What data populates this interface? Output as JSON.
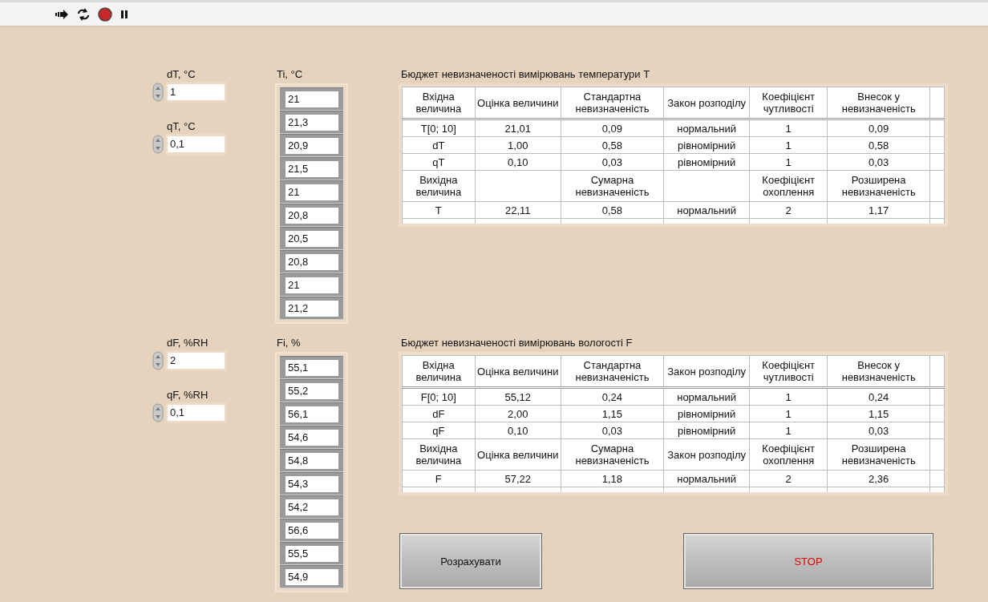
{
  "sections": [
    {
      "params": [
        {
          "label": "dT, °C",
          "value": "1"
        },
        {
          "label": "qT, °C",
          "value": "0,1"
        }
      ],
      "array": {
        "label": "Ti, °C",
        "items": [
          "21",
          "21,3",
          "20,9",
          "21,5",
          "21",
          "20,8",
          "20,5",
          "20,8",
          "21",
          "21,2"
        ]
      },
      "table": {
        "title": "Бюджет невизначеності вимірювань температури T",
        "header": [
          "Вхідна величина",
          "Оцінка величини",
          "Стандартна невизначеність",
          "Закон розподілу",
          "Коефіцієнт чутливості",
          "Внесок у невизначеність"
        ],
        "rows": [
          [
            "T[0; 10]",
            "21,01",
            "0,09",
            "нормальний",
            "1",
            "0,09"
          ],
          [
            "dT",
            "1,00",
            "0,58",
            "рівномірний",
            "1",
            "0,58"
          ],
          [
            "qT",
            "0,10",
            "0,03",
            "рівномірний",
            "1",
            "0,03"
          ]
        ],
        "output_header": {
          "quantity": "Вихідна величина",
          "uncertainty": "Сумарна невизначеність",
          "coefficient": "Коефіцієнт охоплення",
          "result": "Розширена невизначеність"
        },
        "output_rows": [
          [
            "T",
            "22,11",
            "0,58",
            "нормальний",
            "2",
            "1,17"
          ]
        ]
      }
    },
    {
      "params": [
        {
          "label": "dF, %RH",
          "value": "2"
        },
        {
          "label": "qF, %RH",
          "value": "0,1"
        }
      ],
      "array": {
        "label": "Fi,  %",
        "items": [
          "55,1",
          "55,2",
          "56,1",
          "54,6",
          "54,8",
          "54,3",
          "54,2",
          "56,6",
          "55,5",
          "54,9"
        ]
      },
      "table": {
        "title": "Бюджет невизначеності вимірювань вологості F",
        "header": [
          "Вхідна величина",
          "Оцінка величини",
          "Стандартна невизначеність",
          "Закон розподілу",
          "Коефіцієнт чутливості",
          "Внесок у невизначеність"
        ],
        "rows": [
          [
            "F[0; 10]",
            "55,12",
            "0,24",
            "нормальний",
            "1",
            "0,24"
          ],
          [
            "dF",
            "2,00",
            "1,15",
            "рівномірний",
            "1",
            "1,15"
          ],
          [
            "qF",
            "0,10",
            "0,03",
            "рівномірний",
            "1",
            "0,03"
          ]
        ],
        "output_header": {
          "quantity": "Вихідна величина",
          "estimate": "Оцінка величини",
          "uncertainty": "Сумарна невизначеність",
          "distribution": "Закон розподілу",
          "coefficient": "Коефіцієнт охоплення",
          "result": "Розширена невизначеність"
        },
        "output_rows": [
          [
            "F",
            "57,22",
            "1,18",
            "нормальний",
            "2",
            "2,36"
          ]
        ]
      }
    }
  ],
  "buttons": [
    {
      "label": "Розрахувати",
      "kind": "normal"
    },
    {
      "label": "STOP",
      "kind": "stop"
    }
  ]
}
